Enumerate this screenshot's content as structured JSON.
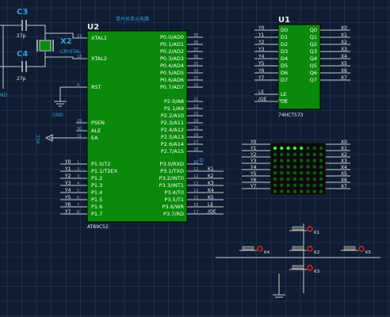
{
  "colors": {
    "background": "#0f1d33",
    "grid": "#2a3d5c",
    "chip_fill": "#0a8a0a",
    "chip_border": "#000000",
    "wire": "#c9c9c9",
    "label_blue": "#2f9bd6",
    "label_white": "#ffffff",
    "led_on": "#3cf03c",
    "led_off": "#0d5d0d",
    "ref_white": "#e8e8e8",
    "red_pin": "#ff2a2a"
  },
  "u2": {
    "ref": "U2",
    "part": "AT89C52",
    "title": "单片机单元电路",
    "left_pins": [
      {
        "name": "XTAL1",
        "num": "19"
      },
      {
        "name": "XTAL2",
        "num": "18"
      },
      {
        "name": "RST",
        "num": "9"
      },
      {
        "name": "PSEN",
        "num": "29"
      },
      {
        "name": "ALE",
        "num": "30"
      },
      {
        "name": "EA",
        "num": "31"
      },
      {
        "name": "P1.0/T2",
        "num": "1"
      },
      {
        "name": "P1.1/T2EX",
        "num": "2"
      },
      {
        "name": "P1.2",
        "num": "3"
      },
      {
        "name": "P1.3",
        "num": "4"
      },
      {
        "name": "P1.4",
        "num": "5"
      },
      {
        "name": "P1.5",
        "num": "6"
      },
      {
        "name": "P1.6",
        "num": "7"
      },
      {
        "name": "P1.7",
        "num": "8"
      }
    ],
    "right_pins": [
      {
        "name": "P0.0/AD0",
        "num": "39"
      },
      {
        "name": "P0.1/AD1",
        "num": "38"
      },
      {
        "name": "P0.2/AD2",
        "num": "37"
      },
      {
        "name": "P0.3/AD3",
        "num": "36"
      },
      {
        "name": "P0.4/AD4",
        "num": "35"
      },
      {
        "name": "P0.5/AD5",
        "num": "34"
      },
      {
        "name": "P0.6/AD6",
        "num": "33"
      },
      {
        "name": "P0.7/AD7",
        "num": "32"
      },
      {
        "name": "P2.0/A8",
        "num": "21"
      },
      {
        "name": "P2.1/A9",
        "num": "22"
      },
      {
        "name": "P2.2/A10",
        "num": "23"
      },
      {
        "name": "P2.3/A11",
        "num": "24"
      },
      {
        "name": "P2.4/A12",
        "num": "25"
      },
      {
        "name": "P2.5/A13",
        "num": "26"
      },
      {
        "name": "P2.6/A14",
        "num": "27"
      },
      {
        "name": "P2.7/A15",
        "num": "28"
      },
      {
        "name": "P3.0/RXD",
        "num": "10"
      },
      {
        "name": "P3.1/TXD",
        "num": "11"
      },
      {
        "name": "P3.2/INT0",
        "num": "12"
      },
      {
        "name": "P3.3/INT1",
        "num": "13"
      },
      {
        "name": "P3.4/T0",
        "num": "14"
      },
      {
        "name": "P3.5/T1",
        "num": "15"
      },
      {
        "name": "P3.6/WR",
        "num": "16"
      },
      {
        "name": "P3.7/RD",
        "num": "17"
      }
    ],
    "left_net_labels": [
      "Y0",
      "Y1",
      "Y2",
      "Y3",
      "Y4",
      "Y5",
      "Y6",
      "Y7"
    ],
    "right_net_labels_p3": [
      "K1",
      "K2",
      "K3",
      "K4",
      "K5",
      "LE",
      "/OE"
    ]
  },
  "u1": {
    "ref": "U1",
    "part": "74HCT573",
    "left_pins": [
      "D0",
      "D1",
      "D2",
      "D3",
      "D4",
      "D5",
      "D6",
      "D7"
    ],
    "right_pins": [
      "Q0",
      "Q1",
      "Q2",
      "Q3",
      "Q4",
      "Q5",
      "Q6",
      "Q7"
    ],
    "ctrl_pins": [
      "LE",
      "OE"
    ],
    "left_nets": [
      "Y0",
      "Y1",
      "Y2",
      "Y3",
      "Y4",
      "Y5",
      "Y6",
      "Y7"
    ],
    "right_nets": [
      "X0",
      "X1",
      "X2",
      "X3",
      "X4",
      "X5",
      "X6",
      "X7"
    ],
    "ctrl_nets": [
      "LE",
      "/OE"
    ]
  },
  "matrix": {
    "left_nets": [
      "Y0",
      "Y1",
      "Y2",
      "Y3",
      "Y4",
      "Y5",
      "Y6",
      "Y7"
    ],
    "right_nets": [
      "X0",
      "X1",
      "X2",
      "X3",
      "X4",
      "X5",
      "X6",
      "X7"
    ],
    "lit_row": 0,
    "lit_count": 5
  },
  "crystal": {
    "c3_ref": "C3",
    "c3_val": "27p",
    "c4_ref": "C4",
    "c4_val": "27p",
    "x2_ref": "X2",
    "x2_part": "CRYSTAL",
    "gnd": "GND",
    "left_gnd": "ND"
  },
  "reset": {
    "gnd": "GND",
    "vcc": "VCC"
  },
  "buttons": {
    "labels": [
      "K1",
      "K2",
      "K3",
      "K4",
      "K5"
    ]
  }
}
